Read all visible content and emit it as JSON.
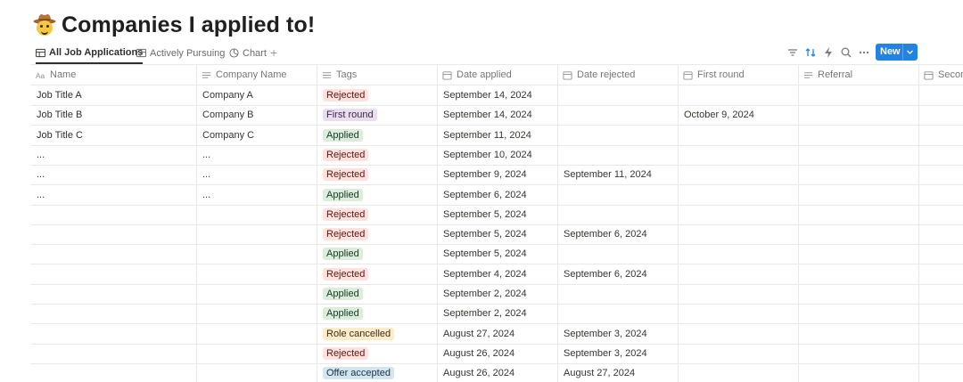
{
  "page": {
    "title": "Companies I applied to!"
  },
  "views": [
    {
      "label": "All Job Applications",
      "icon": "table-icon",
      "active": true
    },
    {
      "label": "Actively Pursuing",
      "icon": "table-icon",
      "active": false
    },
    {
      "label": "Chart",
      "icon": "chart-icon",
      "active": false
    }
  ],
  "toolbar": {
    "new_label": "New"
  },
  "columns": [
    {
      "label": "Name",
      "icon": "title-icon"
    },
    {
      "label": "Company Name",
      "icon": "text-icon"
    },
    {
      "label": "Tags",
      "icon": "multiselect-icon"
    },
    {
      "label": "Date applied",
      "icon": "calendar-icon"
    },
    {
      "label": "Date rejected",
      "icon": "calendar-icon"
    },
    {
      "label": "First round",
      "icon": "calendar-icon"
    },
    {
      "label": "Referral",
      "icon": "text-icon"
    },
    {
      "label": "Secon",
      "icon": "calendar-icon"
    }
  ],
  "tag_colors": {
    "Rejected": {
      "bg": "#ffe2dd",
      "fg": "#5d1715"
    },
    "First round": {
      "bg": "#e8deee",
      "fg": "#412454"
    },
    "Applied": {
      "bg": "#dbeddb",
      "fg": "#1c3829"
    },
    "Role cancelled": {
      "bg": "#fdecc8",
      "fg": "#402c1b"
    },
    "Offer accepted": {
      "bg": "#d3e5ef",
      "fg": "#183347"
    }
  },
  "rows": [
    {
      "name": "Job Title A",
      "company": "Company A",
      "tag": "Rejected",
      "applied": "September 14, 2024",
      "rejected": "",
      "first_round": "",
      "referral": ""
    },
    {
      "name": "Job Title B",
      "company": "Company B",
      "tag": "First round",
      "applied": "September 14, 2024",
      "rejected": "",
      "first_round": "October 9, 2024",
      "referral": ""
    },
    {
      "name": "Job Title C",
      "company": "Company C",
      "tag": "Applied",
      "applied": "September 11, 2024",
      "rejected": "",
      "first_round": "",
      "referral": ""
    },
    {
      "name": "...",
      "company": "...",
      "tag": "Rejected",
      "applied": "September 10, 2024",
      "rejected": "",
      "first_round": "",
      "referral": ""
    },
    {
      "name": "...",
      "company": "...",
      "tag": "Rejected",
      "applied": "September 9, 2024",
      "rejected": "September 11, 2024",
      "first_round": "",
      "referral": ""
    },
    {
      "name": "...",
      "company": "...",
      "tag": "Applied",
      "applied": "September 6, 2024",
      "rejected": "",
      "first_round": "",
      "referral": ""
    },
    {
      "name": "",
      "company": "",
      "tag": "Rejected",
      "applied": "September 5, 2024",
      "rejected": "",
      "first_round": "",
      "referral": ""
    },
    {
      "name": "",
      "company": "",
      "tag": "Rejected",
      "applied": "September 5, 2024",
      "rejected": "September 6, 2024",
      "first_round": "",
      "referral": ""
    },
    {
      "name": "",
      "company": "",
      "tag": "Applied",
      "applied": "September 5, 2024",
      "rejected": "",
      "first_round": "",
      "referral": ""
    },
    {
      "name": "",
      "company": "",
      "tag": "Rejected",
      "applied": "September 4, 2024",
      "rejected": "September 6, 2024",
      "first_round": "",
      "referral": ""
    },
    {
      "name": "",
      "company": "",
      "tag": "Applied",
      "applied": "September 2, 2024",
      "rejected": "",
      "first_round": "",
      "referral": ""
    },
    {
      "name": "",
      "company": "",
      "tag": "Applied",
      "applied": "September 2, 2024",
      "rejected": "",
      "first_round": "",
      "referral": ""
    },
    {
      "name": "",
      "company": "",
      "tag": "Role cancelled",
      "applied": "August 27, 2024",
      "rejected": "September 3, 2024",
      "first_round": "",
      "referral": ""
    },
    {
      "name": "",
      "company": "",
      "tag": "Rejected",
      "applied": "August 26, 2024",
      "rejected": "September 3, 2024",
      "first_round": "",
      "referral": ""
    },
    {
      "name": "",
      "company": "",
      "tag": "Offer accepted",
      "applied": "August 26, 2024",
      "rejected": "August 27, 2024",
      "first_round": "",
      "referral": ""
    }
  ]
}
